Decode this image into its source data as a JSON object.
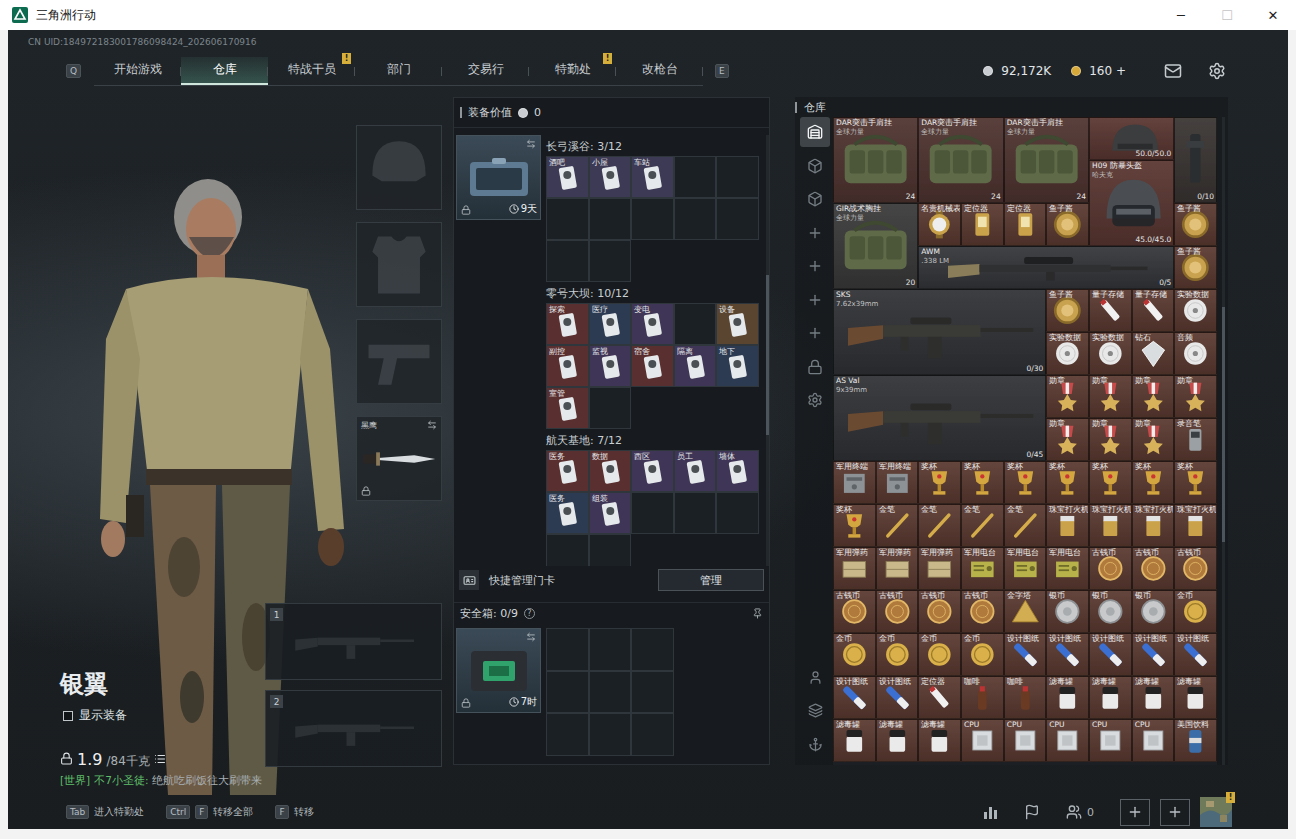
{
  "window": {
    "title": "三角洲行动",
    "controls": [
      {
        "glyph": "─",
        "disabled": false
      },
      {
        "glyph": "☐",
        "disabled": true
      },
      {
        "glyph": "✕",
        "disabled": false
      }
    ]
  },
  "uid": "CN UID:184972183001786098424_202606170916",
  "nav": {
    "prevKey": "Q",
    "nextKey": "E",
    "tabs": [
      {
        "label": "开始游戏",
        "selected": false
      },
      {
        "label": "仓库",
        "selected": true
      },
      {
        "label": "特战干员",
        "selected": false,
        "badge": "!"
      },
      {
        "label": "部门",
        "selected": false
      },
      {
        "label": "交易行",
        "selected": false
      },
      {
        "label": "特勤处",
        "selected": false,
        "badge": "!"
      },
      {
        "label": "改枪台",
        "selected": false
      }
    ]
  },
  "currency": {
    "coins": "92,172K",
    "premium": "160",
    "add": "+"
  },
  "operator": {
    "name": "银翼",
    "showGear": {
      "label": "显示装备",
      "checked": false
    },
    "weight": {
      "current": "1.9",
      "max": "/84千克"
    }
  },
  "chat": {
    "channel": "[世界]",
    "user": "不7小圣徒:",
    "message": "绝航吃刷饭往大刷带来"
  },
  "gearSlots": [
    {
      "kind": "helmet",
      "empty": true
    },
    {
      "kind": "armor",
      "empty": true
    },
    {
      "kind": "pistol",
      "empty": true
    },
    {
      "kind": "melee",
      "empty": false,
      "label": "黑鹰",
      "locked": true
    }
  ],
  "weaponSlots": [
    {
      "number": "1",
      "empty": true
    },
    {
      "number": "2",
      "empty": true
    }
  ],
  "equipmentValue": {
    "label": "装备价值",
    "value": "0"
  },
  "keycardCase": {
    "time": "9天",
    "locked": true
  },
  "keycardSections": [
    {
      "title": "长弓溪谷: 3/12",
      "slots": [
        {
          "filled": true,
          "name": "酒吧",
          "color": "#3d3a55"
        },
        {
          "filled": true,
          "name": "小屋",
          "color": "#3d3a55"
        },
        {
          "filled": true,
          "name": "车站",
          "color": "#3d3a55"
        },
        {
          "filled": false
        },
        {
          "filled": false
        },
        {
          "filled": false
        },
        {
          "filled": false
        },
        {
          "filled": false
        },
        {
          "filled": false
        },
        {
          "filled": false
        },
        {
          "filled": false
        },
        {
          "filled": false
        }
      ]
    },
    {
      "title": "零号大坝: 10/12",
      "slots": [
        {
          "filled": true,
          "name": "探索",
          "color": "#5a2f2f"
        },
        {
          "filled": true,
          "name": "医疗",
          "color": "#2c3a52"
        },
        {
          "filled": true,
          "name": "变电",
          "color": "#3f3556"
        },
        {
          "filled": false
        },
        {
          "filled": true,
          "name": "设备",
          "color": "#5a4530"
        },
        {
          "filled": true,
          "name": "副控",
          "color": "#5a2f2f"
        },
        {
          "filled": true,
          "name": "监视",
          "color": "#3f3556"
        },
        {
          "filled": true,
          "name": "宿舍",
          "color": "#5a2f2f"
        },
        {
          "filled": true,
          "name": "隔离",
          "color": "#3f3556"
        },
        {
          "filled": true,
          "name": "地下",
          "color": "#2c3a52"
        },
        {
          "filled": true,
          "name": "室管",
          "color": "#5a2f2f"
        },
        {
          "filled": false
        }
      ]
    },
    {
      "title": "航天基地: 7/12",
      "slots": [
        {
          "filled": true,
          "name": "医务",
          "color": "#5a2f2f"
        },
        {
          "filled": true,
          "name": "数据",
          "color": "#5a2f2f"
        },
        {
          "filled": true,
          "name": "西区",
          "color": "#3f3556"
        },
        {
          "filled": true,
          "name": "员工",
          "color": "#3f3556"
        },
        {
          "filled": true,
          "name": "墙体",
          "color": "#3f3556"
        },
        {
          "filled": true,
          "name": "医务",
          "color": "#2c3a52"
        },
        {
          "filled": true,
          "name": "组装",
          "color": "#3f3556"
        },
        {
          "filled": false
        },
        {
          "filled": false
        },
        {
          "filled": false
        },
        {
          "filled": false
        },
        {
          "filled": false
        }
      ]
    }
  ],
  "manageCards": {
    "label": "快捷管理门卡",
    "button": "管理"
  },
  "safeBox": {
    "title": "安全箱: 0/9",
    "help": "?",
    "time": "7时",
    "locked": true,
    "slots": [
      {
        "filled": false
      },
      {
        "filled": false
      },
      {
        "filled": false
      },
      {
        "filled": false
      },
      {
        "filled": false
      },
      {
        "filled": false
      },
      {
        "filled": false
      },
      {
        "filled": false
      },
      {
        "filled": false
      }
    ]
  },
  "warehouse": {
    "title": "仓库",
    "sideTabs": [
      {
        "selected": true
      },
      {
        "selected": false
      },
      {
        "selected": false
      },
      {
        "selected": false
      },
      {
        "selected": false
      },
      {
        "selected": false
      },
      {
        "selected": false
      },
      {
        "selected": false
      },
      {
        "selected": false
      }
    ],
    "items": [
      {
        "kind": "bag",
        "name": "DAR突击手肩挂",
        "sub": "全球力量",
        "info": "24",
        "color": "#4f3430"
      },
      {
        "kind": "bag",
        "name": "DAR突击手肩挂",
        "sub": "全球力量",
        "info": "24",
        "color": "#4f3430"
      },
      {
        "kind": "bag",
        "name": "DAR突击手肩挂",
        "sub": "全球力量",
        "info": "24",
        "color": "#4f3430"
      },
      {
        "kind": "helmetcut",
        "info": "50.0/50.0",
        "color": "#5a3631"
      },
      {
        "kind": "tall",
        "info": "0/10",
        "color": "#3a3533"
      },
      {
        "kind": "helmet",
        "name": "H09 防暴头盔",
        "sub": "哈夫克",
        "info": "45.0/45.0",
        "color": "#5a3631"
      },
      {
        "kind": "bag",
        "name": "GIR战术胸挂",
        "sub": "全球力量",
        "info": "20",
        "color": "#3b3a3a"
      },
      {
        "kind": "watch",
        "name": "名贵机械表",
        "color": "#5b3a31"
      },
      {
        "kind": "locator",
        "name": "定位器",
        "color": "#5b3a31"
      },
      {
        "kind": "locator",
        "name": "定位器",
        "color": "#5b3a31"
      },
      {
        "kind": "tin",
        "name": "鱼子酱",
        "color": "#5b3a31"
      },
      {
        "kind": "tin",
        "name": "鱼子酱",
        "color": "#5b3a31"
      },
      {
        "kind": "sniper",
        "name": "AWM",
        "sub": ".338 LM",
        "info": "0/5",
        "color": "#34363a"
      },
      {
        "kind": "tin",
        "name": "鱼子酱",
        "color": "#5b3a31"
      },
      {
        "kind": "rifle",
        "name": "SKS",
        "sub": "7.62x39mm",
        "info": "0/30",
        "color": "#303236"
      },
      {
        "kind": "tin",
        "name": "鱼子酱",
        "color": "#5b3a31"
      },
      {
        "kind": "usb",
        "name": "量子存储",
        "color": "#5b3a31"
      },
      {
        "kind": "usb",
        "name": "量子存储",
        "color": "#5b3a31"
      },
      {
        "kind": "disc",
        "name": "实验数据",
        "color": "#5b3a31"
      },
      {
        "kind": "disc",
        "name": "实验数据",
        "color": "#5b3a31"
      },
      {
        "kind": "disc",
        "name": "实验数据",
        "color": "#5b3a31"
      },
      {
        "kind": "diamond",
        "name": "钻石",
        "color": "#5b3a31"
      },
      {
        "kind": "disc",
        "name": "音频",
        "color": "#5b3a31"
      },
      {
        "kind": "rifle",
        "name": "AS Val",
        "sub": "9x39mm",
        "info": "0/45",
        "color": "#303236"
      },
      {
        "kind": "medal",
        "name": "勋章",
        "color": "#5b3a31"
      },
      {
        "kind": "medal",
        "name": "勋章",
        "color": "#5b3a31"
      },
      {
        "kind": "medal",
        "name": "勋章",
        "color": "#5b3a31"
      },
      {
        "kind": "medal",
        "name": "勋章",
        "color": "#5b3a31"
      },
      {
        "kind": "medal",
        "name": "勋章",
        "color": "#5b3a31"
      },
      {
        "kind": "medal",
        "name": "勋章",
        "color": "#5b3a31"
      },
      {
        "kind": "medal",
        "name": "勋章",
        "color": "#5b3a31"
      },
      {
        "kind": "recorder",
        "name": "录音笔",
        "color": "#5b3a31"
      },
      {
        "kind": "box",
        "name": "军用终端",
        "color": "#5b3a31"
      },
      {
        "kind": "box",
        "name": "军用终端",
        "color": "#5b3a31"
      },
      {
        "kind": "cup",
        "name": "奖杯",
        "color": "#5b3a31"
      },
      {
        "kind": "cup",
        "name": "奖杯",
        "color": "#5b3a31"
      },
      {
        "kind": "cup",
        "name": "奖杯",
        "color": "#5b3a31"
      },
      {
        "kind": "cup",
        "name": "奖杯",
        "color": "#5b3a31"
      },
      {
        "kind": "cup",
        "name": "奖杯",
        "color": "#5b3a31"
      },
      {
        "kind": "cup",
        "name": "奖杯",
        "color": "#5b3a31"
      },
      {
        "kind": "cup",
        "name": "奖杯",
        "color": "#5b3a31"
      },
      {
        "kind": "cup",
        "name": "奖杯",
        "color": "#5b3a31"
      },
      {
        "kind": "pen",
        "name": "金笔",
        "color": "#5b3a31"
      },
      {
        "kind": "pen",
        "name": "金笔",
        "color": "#5b3a31"
      },
      {
        "kind": "pen",
        "name": "金笔",
        "color": "#5b3a31"
      },
      {
        "kind": "pen",
        "name": "金笔",
        "color": "#5b3a31"
      },
      {
        "kind": "lighter",
        "name": "珠宝打火机",
        "color": "#5b3a31"
      },
      {
        "kind": "lighter",
        "name": "珠宝打火机",
        "color": "#5b3a31"
      },
      {
        "kind": "lighter",
        "name": "珠宝打火机",
        "color": "#5b3a31"
      },
      {
        "kind": "lighter",
        "name": "珠宝打火机",
        "color": "#5b3a31"
      },
      {
        "kind": "crate",
        "name": "军用弹药",
        "color": "#5b3a31"
      },
      {
        "kind": "crate",
        "name": "军用弹药",
        "color": "#5b3a31"
      },
      {
        "kind": "crate",
        "name": "军用弹药",
        "color": "#5b3a31"
      },
      {
        "kind": "radio",
        "name": "军用电台",
        "color": "#5b3a31"
      },
      {
        "kind": "radio",
        "name": "军用电台",
        "color": "#5b3a31"
      },
      {
        "kind": "radio",
        "name": "军用电台",
        "color": "#5b3a31"
      },
      {
        "kind": "coin",
        "name": "古钱币",
        "color": "#5b3a31"
      },
      {
        "kind": "coin",
        "name": "古钱币",
        "color": "#5b3a31"
      },
      {
        "kind": "coin",
        "name": "古钱币",
        "color": "#5b3a31"
      },
      {
        "kind": "coin",
        "name": "古钱币",
        "color": "#5b3a31"
      },
      {
        "kind": "coin",
        "name": "古钱币",
        "color": "#5b3a31"
      },
      {
        "kind": "coin",
        "name": "古钱币",
        "color": "#5b3a31"
      },
      {
        "kind": "coin",
        "name": "古钱币",
        "color": "#5b3a31"
      },
      {
        "kind": "pyramid",
        "name": "金字塔",
        "color": "#5b3a31"
      },
      {
        "kind": "silver",
        "name": "银币",
        "color": "#5b3a31"
      },
      {
        "kind": "silver",
        "name": "银币",
        "color": "#5b3a31"
      },
      {
        "kind": "silver",
        "name": "银币",
        "color": "#5b3a31"
      },
      {
        "kind": "goldcoin",
        "name": "金币",
        "color": "#5b3a31"
      },
      {
        "kind": "goldcoin",
        "name": "金币",
        "color": "#5b3a31"
      },
      {
        "kind": "goldcoin",
        "name": "金币",
        "color": "#5b3a31"
      },
      {
        "kind": "goldcoin",
        "name": "金币",
        "color": "#5b3a31"
      },
      {
        "kind": "goldcoin",
        "name": "金币",
        "color": "#5b3a31"
      },
      {
        "kind": "tube",
        "name": "设计图纸",
        "color": "#5b3a31"
      },
      {
        "kind": "tube",
        "name": "设计图纸",
        "color": "#5b3a31"
      },
      {
        "kind": "tube",
        "name": "设计图纸",
        "color": "#5b3a31"
      },
      {
        "kind": "tube",
        "name": "设计图纸",
        "color": "#5b3a31"
      },
      {
        "kind": "tube",
        "name": "设计图纸",
        "color": "#5b3a31"
      },
      {
        "kind": "tube",
        "name": "设计图纸",
        "color": "#5b3a31"
      },
      {
        "kind": "tube",
        "name": "设计图纸",
        "color": "#5b3a31"
      },
      {
        "kind": "usb",
        "name": "定位器",
        "color": "#5b3a31"
      },
      {
        "kind": "bottle",
        "name": "咖啡",
        "color": "#5b3a31"
      },
      {
        "kind": "bottle",
        "name": "咖啡",
        "color": "#5b3a31"
      },
      {
        "kind": "canister",
        "name": "滤毒罐",
        "color": "#5b3a31"
      },
      {
        "kind": "canister",
        "name": "滤毒罐",
        "color": "#5b3a31"
      },
      {
        "kind": "canister",
        "name": "滤毒罐",
        "color": "#5b3a31"
      },
      {
        "kind": "canister",
        "name": "滤毒罐",
        "color": "#5b3a31"
      },
      {
        "kind": "canister",
        "name": "滤毒罐",
        "color": "#5b3a31"
      },
      {
        "kind": "canister",
        "name": "滤毒罐",
        "color": "#5b3a31"
      },
      {
        "kind": "canister",
        "name": "滤毒罐",
        "color": "#5b3a31"
      },
      {
        "kind": "cpu",
        "name": "CPU",
        "color": "#5b3a31"
      },
      {
        "kind": "cpu",
        "name": "CPU",
        "color": "#5b3a31"
      },
      {
        "kind": "cpu",
        "name": "CPU",
        "color": "#5b3a31"
      },
      {
        "kind": "cpu",
        "name": "CPU",
        "color": "#5b3a31"
      },
      {
        "kind": "cpu",
        "name": "CPU",
        "color": "#5b3a31"
      },
      {
        "kind": "can",
        "name": "美国饮料",
        "color": "#5b3a31"
      }
    ]
  },
  "hints": [
    {
      "keys": [
        "Tab"
      ],
      "label": "进入特勤处"
    },
    {
      "keys": [
        "Ctrl",
        "F"
      ],
      "label": "转移全部"
    },
    {
      "keys": [
        "F"
      ],
      "label": "转移"
    }
  ],
  "social": {
    "friends": "0"
  },
  "map": {
    "badge": "!"
  }
}
